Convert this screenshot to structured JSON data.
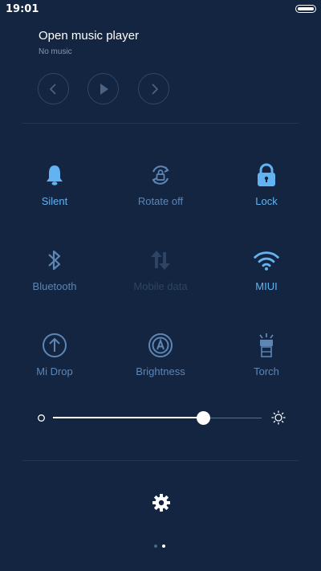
{
  "status_bar": {
    "time": "19:01",
    "battery_icon": "battery-full-icon"
  },
  "music": {
    "title": "Open music player",
    "subtitle": "No music",
    "controls": [
      {
        "name": "previous",
        "icon": "chevron-left-icon"
      },
      {
        "name": "play",
        "icon": "play-icon"
      },
      {
        "name": "next",
        "icon": "chevron-right-icon"
      }
    ]
  },
  "toggles": [
    {
      "label": "Silent",
      "icon": "bell-icon",
      "state": "on"
    },
    {
      "label": "Rotate off",
      "icon": "rotate-lock-icon",
      "state": "off"
    },
    {
      "label": "Lock",
      "icon": "lock-icon",
      "state": "on"
    },
    {
      "label": "Bluetooth",
      "icon": "bluetooth-icon",
      "state": "off"
    },
    {
      "label": "Mobile data",
      "icon": "mobile-data-icon",
      "state": "disabled"
    },
    {
      "label": "MIUI",
      "icon": "wifi-icon",
      "state": "on"
    },
    {
      "label": "Mi Drop",
      "icon": "mi-drop-icon",
      "state": "off"
    },
    {
      "label": "Brightness",
      "icon": "auto-brightness-icon",
      "state": "off"
    },
    {
      "label": "Torch",
      "icon": "torch-icon",
      "state": "off"
    }
  ],
  "brightness": {
    "level": 0.72
  },
  "settings": {
    "icon": "gear-icon"
  },
  "pager": {
    "pages": 2,
    "current": 2
  },
  "colors": {
    "background": "#132540",
    "active": "#63b3f2",
    "inactive": "#5e86b4",
    "disabled": "#2e4462"
  }
}
